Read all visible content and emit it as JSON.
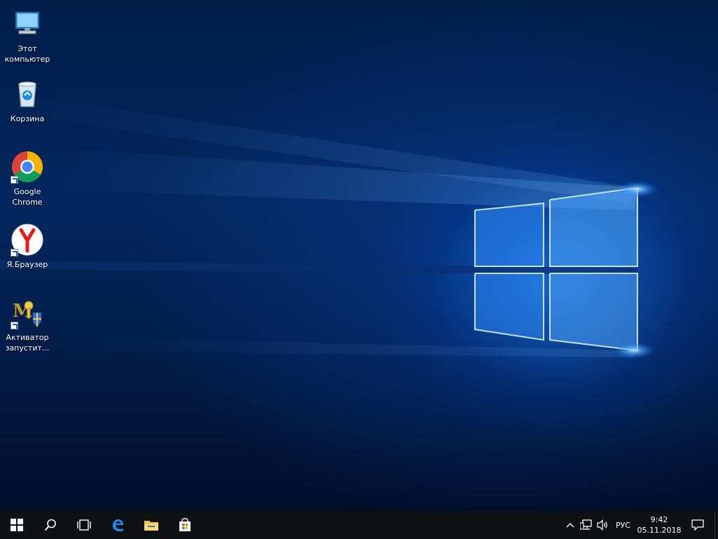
{
  "desktop": {
    "icons": [
      {
        "label": "Этот\nкомпьютер",
        "icon": "this-pc-icon"
      },
      {
        "label": "Корзина",
        "icon": "recycle-bin-icon"
      },
      {
        "label": "Google\nChrome",
        "icon": "chrome-icon"
      },
      {
        "label": "Я.Браузер",
        "icon": "yandex-browser-icon"
      },
      {
        "label": "Активатор\nзапустит...",
        "icon": "activator-icon"
      }
    ]
  },
  "taskbar": {
    "buttons": [
      {
        "name": "start-icon"
      },
      {
        "name": "search-icon"
      },
      {
        "name": "task-view-icon"
      },
      {
        "name": "edge-icon"
      },
      {
        "name": "file-explorer-icon"
      },
      {
        "name": "store-icon"
      }
    ],
    "tray": {
      "language": "РУС",
      "time": "9:42",
      "date": "05.11.2018"
    }
  },
  "colors": {
    "taskbar_bg": "#0e1114",
    "accent": "#1a8cff"
  }
}
